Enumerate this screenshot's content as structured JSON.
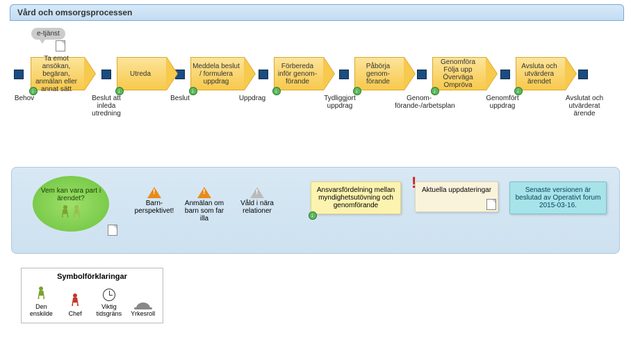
{
  "header": {
    "title": "Vård och omsorgsprocessen"
  },
  "speech": {
    "label": "e-tjänst"
  },
  "process": {
    "steps": [
      {
        "label": "Ta emot ansökan, begäran, anmälan eller annat sätt"
      },
      {
        "label": "Utreda"
      },
      {
        "label": "Meddela beslut / formulera uppdrag"
      },
      {
        "label": "Förbereda inför genom-förande"
      },
      {
        "label": "Påbörja genom-förande"
      },
      {
        "label": "Genomföra Följa upp Överväga Ompröva"
      },
      {
        "label": "Avsluta och utvärdera ärendet"
      }
    ],
    "gates": [
      {
        "label": "Behov"
      },
      {
        "label": "Beslut att inleda utredning"
      },
      {
        "label": "Beslut"
      },
      {
        "label": "Uppdrag"
      },
      {
        "label": "Tydliggjort uppdrag"
      },
      {
        "label": "Genom-förande-/arbetsplan"
      },
      {
        "label": "Genomfört uppdrag"
      },
      {
        "label": "Avslutat och utvärderat ärende"
      }
    ]
  },
  "info": {
    "oval": "Vem kan vara part i ärendet?",
    "items": [
      "Barn-perspektivet!",
      "Anmälan om barn som far illa",
      "Våld i nära relationer"
    ],
    "stickies": [
      "Ansvarsfördelning mellan myndighetsutövning och genomförande",
      "Aktuella uppdateringar",
      "Senaste versionen är beslutad av Operativt forum 2015-03-16."
    ]
  },
  "legend": {
    "title": "Symbolförklaringar",
    "items": [
      "Den enskilde",
      "Chef",
      "Viktig tidsgräns",
      "Yrkesroll"
    ]
  }
}
